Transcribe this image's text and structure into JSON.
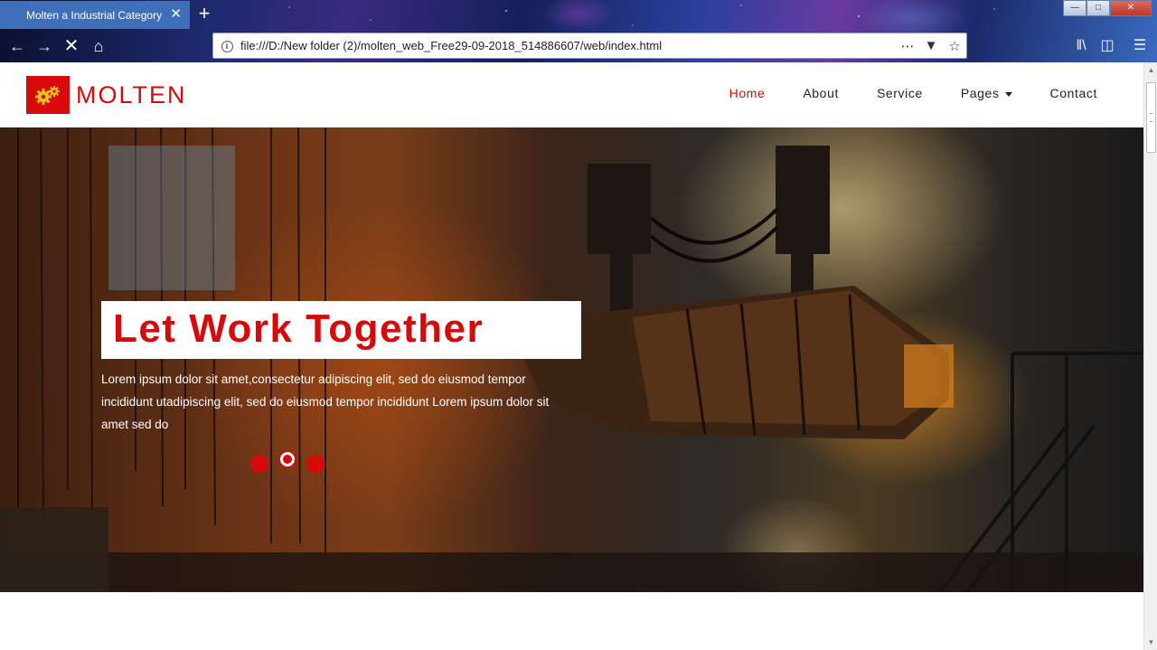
{
  "browser": {
    "tab_title": "Molten a Industrial Category Bo",
    "tab_close": "✕",
    "new_tab": "+",
    "url": "file:///D:/New folder (2)/molten_web_Free29-09-2018_514886607/web/index.html",
    "icons": {
      "back": "back-arrow-icon",
      "forward": "forward-arrow-icon",
      "stop": "stop-icon",
      "home": "home-icon",
      "info": "info-icon",
      "more": "more-dots-icon",
      "pocket": "pocket-icon",
      "bookmark": "star-icon",
      "library": "library-icon",
      "sidebar": "sidebar-icon",
      "menu": "hamburger-menu-icon"
    },
    "window_controls": [
      "minimize",
      "maximize",
      "close"
    ]
  },
  "site": {
    "logo": {
      "text": "MOLTEN",
      "icon": "gears-icon"
    },
    "nav": [
      {
        "label": "Home",
        "active": true
      },
      {
        "label": "About",
        "active": false
      },
      {
        "label": "Service",
        "active": false
      },
      {
        "label": "Pages",
        "active": false,
        "dropdown": true
      },
      {
        "label": "Contact",
        "active": false
      }
    ],
    "hero": {
      "title": "Let Work Together",
      "text": "Lorem ipsum dolor sit amet,consectetur adipiscing elit, sed do eiusmod tempor incididunt utadipiscing elit, sed do eiusmod tempor incididunt Lorem ipsum dolor sit amet sed do",
      "slides": 3,
      "active_slide": 2
    },
    "colors": {
      "brand": "#d60a0a"
    }
  }
}
